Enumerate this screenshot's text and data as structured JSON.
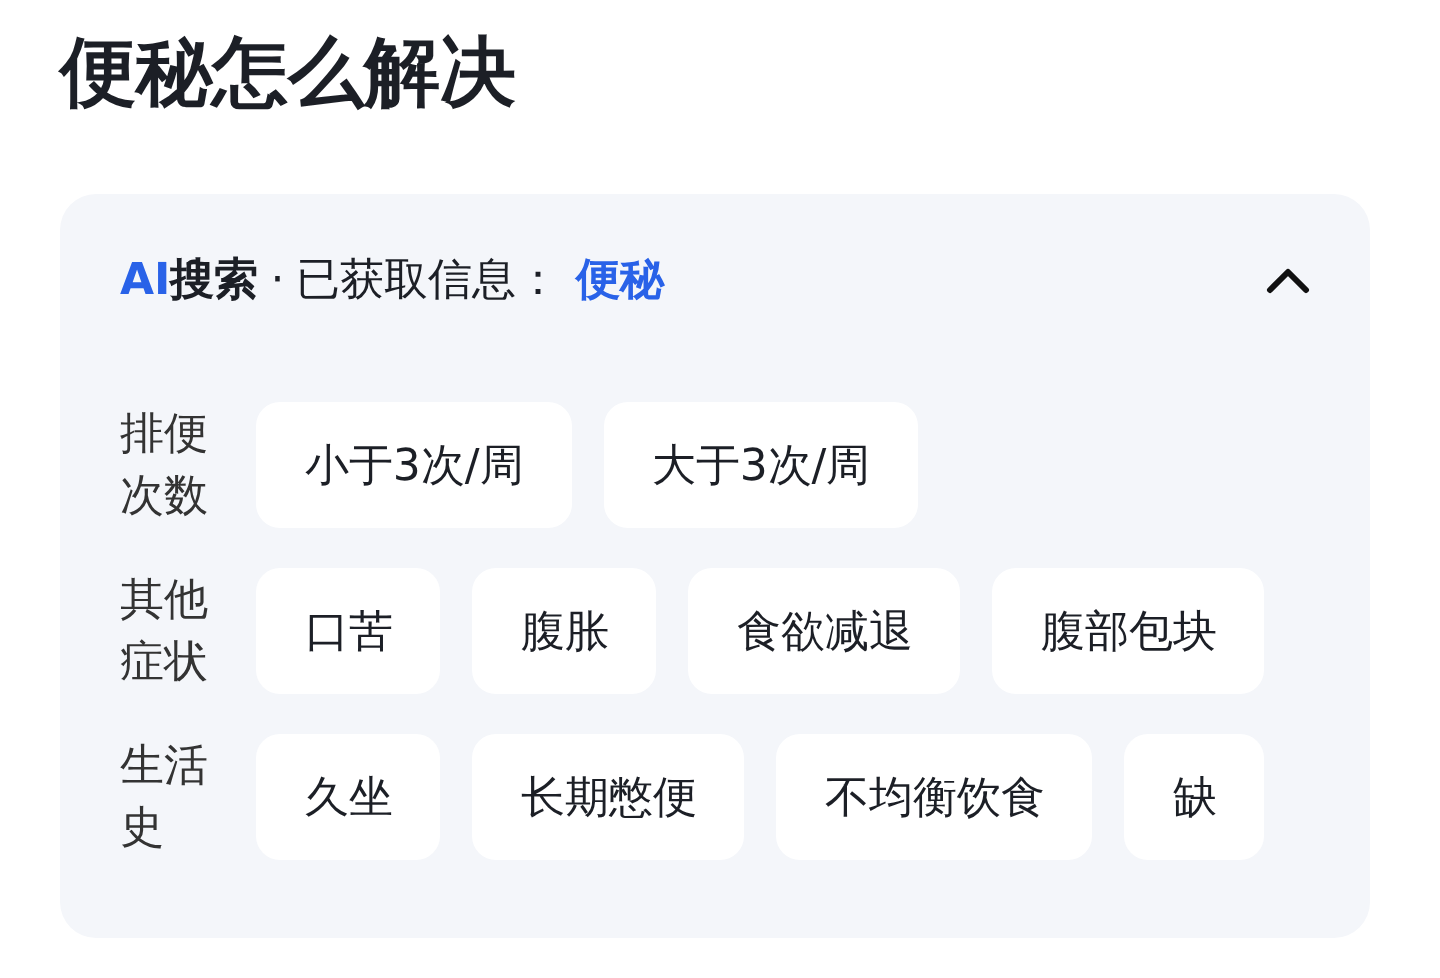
{
  "title": "便秘怎么解决",
  "ai_search": {
    "brand": "AI",
    "label": "搜索",
    "separator": "·",
    "info_label": "已获取信息：",
    "keyword": "便秘",
    "expanded": true,
    "groups": [
      {
        "label": "排便次数",
        "chips": [
          "小于3次/周",
          "大于3次/周"
        ]
      },
      {
        "label": "其他症状",
        "chips": [
          "口苦",
          "腹胀",
          "食欲减退",
          "腹部包块"
        ]
      },
      {
        "label": "生活史",
        "chips": [
          "久坐",
          "长期憋便",
          "不均衡饮食",
          "缺"
        ]
      }
    ]
  }
}
